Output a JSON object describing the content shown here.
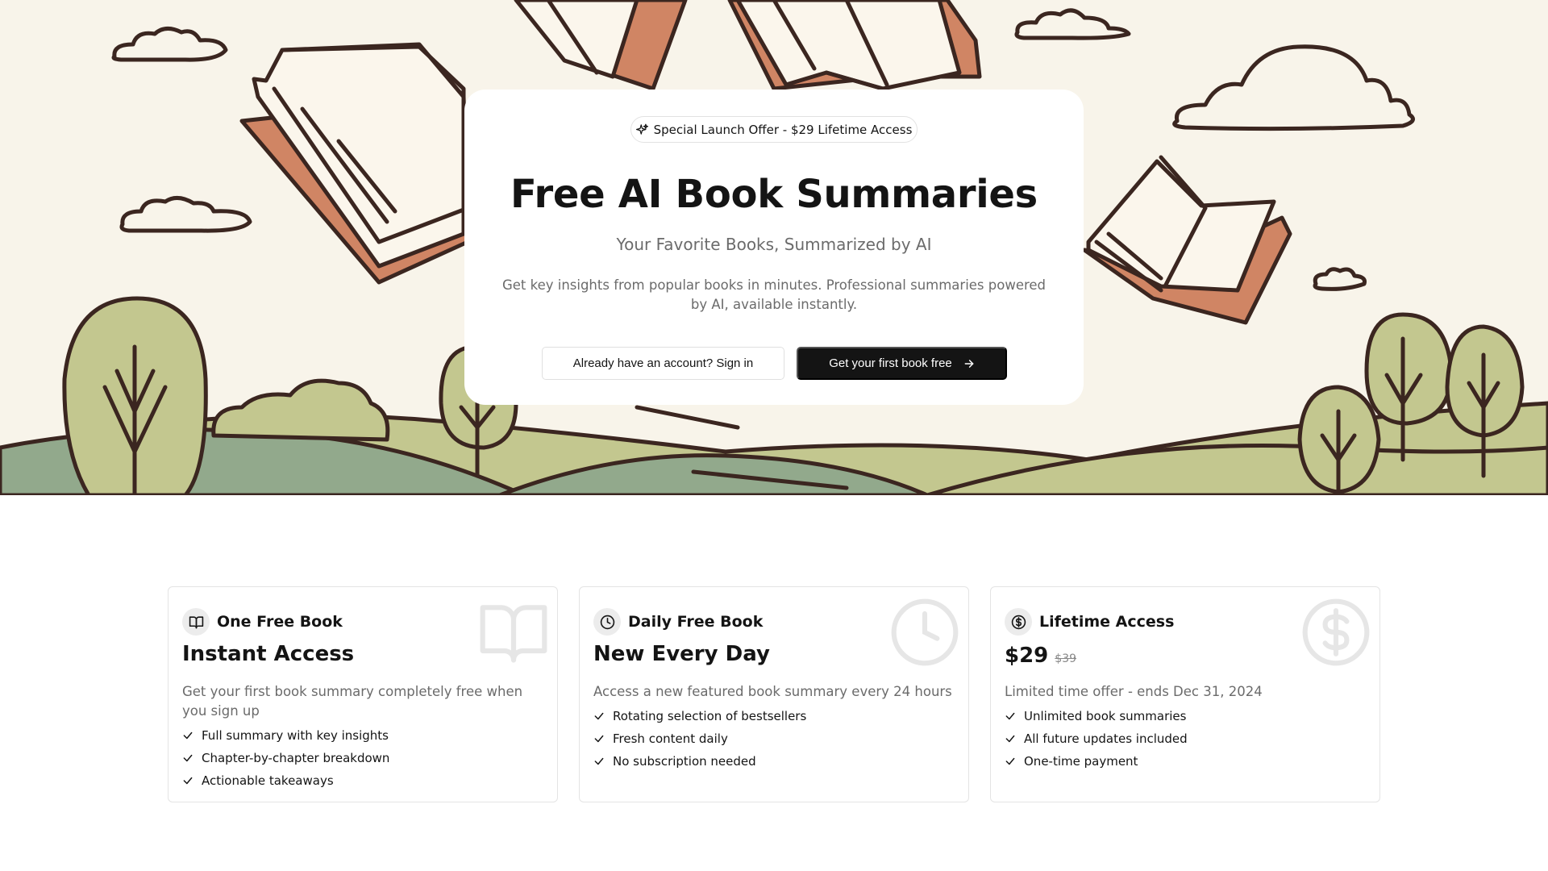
{
  "hero": {
    "badge": "Special Launch Offer - $29 Lifetime Access",
    "badge_icon": "sparkles-icon",
    "title": "Free AI Book Summaries",
    "subtitle": "Your Favorite Books, Summarized by AI",
    "description": "Get key insights from popular books in minutes. Professional summaries powered by AI, available instantly.",
    "signin_button": "Already have an account? Sign in",
    "cta_button": "Get your first book free",
    "cta_icon": "arrow-right-icon"
  },
  "cards": [
    {
      "icon": "book-open-icon",
      "label": "One Free Book",
      "title": "Instant Access",
      "description": "Get your first book summary completely free when you sign up",
      "features": [
        "Full summary with key insights",
        "Chapter-by-chapter breakdown",
        "Actionable takeaways"
      ]
    },
    {
      "icon": "clock-icon",
      "label": "Daily Free Book",
      "title": "New Every Day",
      "description": "Access a new featured book summary every 24 hours",
      "features": [
        "Rotating selection of bestsellers",
        "Fresh content daily",
        "No subscription needed"
      ]
    },
    {
      "icon": "dollar-circle-icon",
      "label": "Lifetime Access",
      "price": "$29",
      "old_price": "$39",
      "description": "Limited time offer - ends Dec 31, 2024",
      "features": [
        "Unlimited book summaries",
        "All future updates included",
        "One-time payment"
      ]
    }
  ],
  "colors": {
    "hero_background": "#f8f4ea",
    "hill_light": "#c3c78f",
    "hill_sage": "#92a98c",
    "book_cover": "#d08564",
    "outline": "#3b2620",
    "primary_button": "#141414"
  }
}
